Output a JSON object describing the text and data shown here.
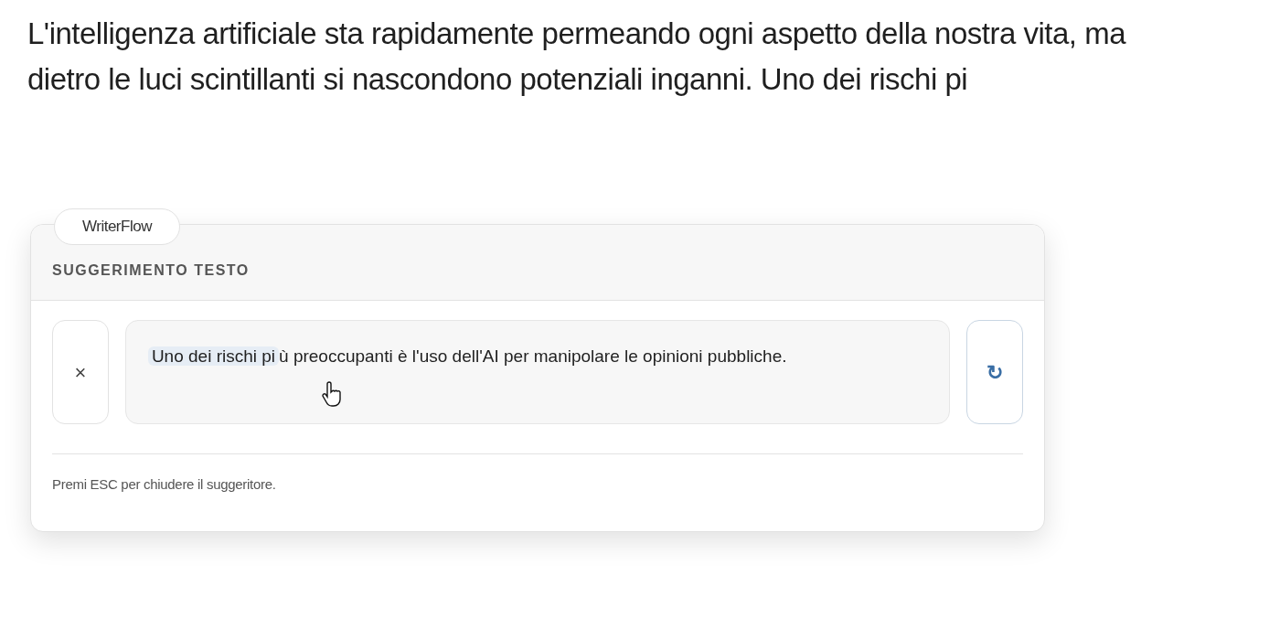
{
  "paragraph": "L'intelligenza artificiale sta rapidamente permeando ogni aspetto della nostra vita, ma dietro le luci scintillanti si nascondono potenziali inganni. Uno dei rischi pi",
  "popup": {
    "badge": "WriterFlow",
    "header": "SUGGERIMENTO TESTO",
    "suggestion": {
      "highlighted": "Uno dei rischi pi",
      "rest": "ù preoccupanti è l'uso dell'AI per manipolare le opinioni pubbliche."
    },
    "close_button": "×",
    "refresh_button": "↻",
    "footer": "Premi ESC per chiudere il suggeritore."
  }
}
